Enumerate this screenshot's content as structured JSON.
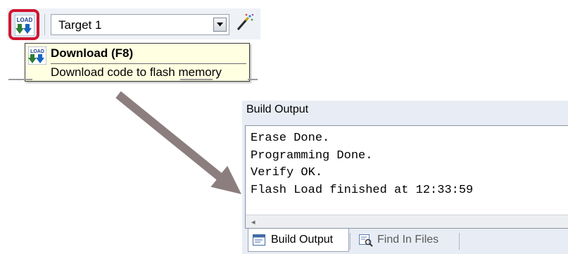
{
  "toolbar": {
    "load_icon_text": "LOAD",
    "target_value": "Target 1"
  },
  "tooltip": {
    "icon_text": "LOAD",
    "title": "Download (F8)",
    "description": "Download code to flash memory"
  },
  "build_output": {
    "title": "Build Output",
    "lines": "Erase Done.\nProgramming Done.\nVerify OK.\nFlash Load finished at 12:33:59",
    "scroll_left_glyph": "◂",
    "tabs": [
      {
        "label": "Build Output"
      },
      {
        "label": "Find In Files"
      }
    ]
  },
  "colors": {
    "highlight_border": "#d2152f",
    "arrow": "#8c7e7f",
    "tooltip_bg": "#ffffe1",
    "panel_bg": "#e8edf5"
  },
  "icons": {
    "load": "load-download-icon",
    "combo_arrow": "chevron-down-icon",
    "wizard": "magic-wand-icon",
    "build_output_tab": "window-icon",
    "find_in_files_tab": "find-in-files-icon"
  }
}
